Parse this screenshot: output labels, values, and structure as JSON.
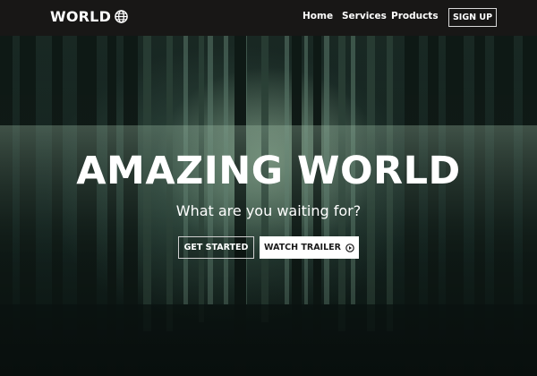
{
  "navbar": {
    "brand": "WORLD",
    "brand_icon": "globe-icon",
    "links": [
      {
        "label": "Home"
      },
      {
        "label": "Services"
      },
      {
        "label": "Products"
      }
    ],
    "signup_label": "SIGN UP"
  },
  "hero": {
    "title": "AMAZING WORLD",
    "subtitle": "What are you waiting for?",
    "primary_button": "GET STARTED",
    "secondary_button": "WATCH TRAILER",
    "secondary_icon": "play-circle-icon"
  },
  "colors": {
    "navbar_bg": "#181716",
    "text": "#ffffff",
    "button_light_bg": "#ffffff",
    "button_dark_text": "#1a1a1a"
  }
}
